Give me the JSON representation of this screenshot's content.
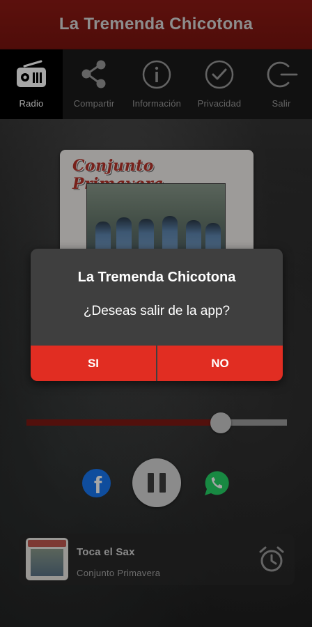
{
  "app": {
    "title": "La Tremenda Chicotona"
  },
  "nav": {
    "items": [
      {
        "label": "Radio",
        "icon": "radio-icon",
        "active": true
      },
      {
        "label": "Compartir",
        "icon": "share-icon"
      },
      {
        "label": "Información",
        "icon": "info-icon"
      },
      {
        "label": "Privacidad",
        "icon": "check-circle-icon"
      },
      {
        "label": "Salir",
        "icon": "exit-icon"
      }
    ]
  },
  "album": {
    "band_text": "Conjunto Primavera"
  },
  "dialog": {
    "title": "La Tremenda Chicotona",
    "message": "¿Deseas salir de la app?",
    "yes_label": "SI",
    "no_label": "NO"
  },
  "player": {
    "progress": 0.74,
    "state": "playing",
    "song": "Toca el Sax",
    "artist": "Conjunto Primavera"
  },
  "colors": {
    "header_bg": "#8d1a14",
    "accent_red": "#e12d22",
    "progress_fill": "#7e1a13",
    "facebook_blue": "#1877f2",
    "whatsapp_green": "#25d366"
  }
}
